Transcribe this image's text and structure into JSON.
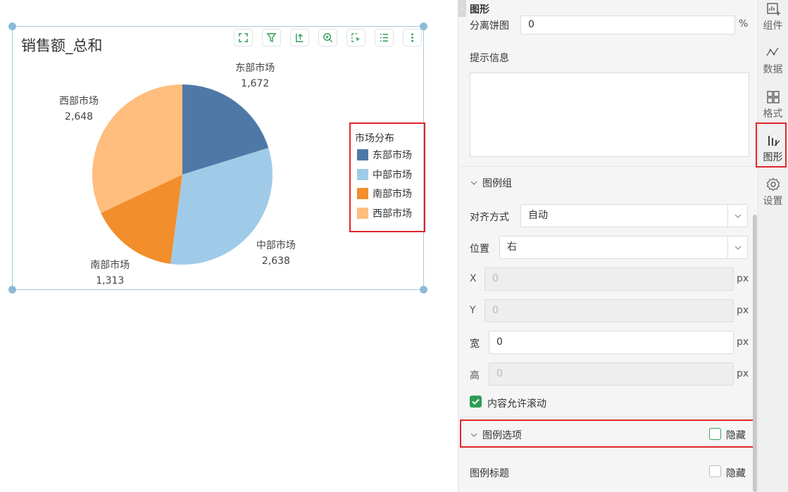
{
  "widget": {
    "title": "销售额_总和",
    "toolbar": [
      "expand-icon",
      "filter-icon",
      "drill-icon",
      "zoom-in-icon",
      "select-icon",
      "list-icon",
      "more-icon"
    ]
  },
  "chart_data": {
    "type": "pie",
    "title": "销售额_总和",
    "categories": [
      "东部市场",
      "中部市场",
      "南部市场",
      "西部市场"
    ],
    "values": [
      1672,
      2638,
      1313,
      2648
    ],
    "value_labels": [
      "1,672",
      "2,638",
      "1,313",
      "2,648"
    ],
    "colors": [
      "#4e79a7",
      "#a0cbe8",
      "#f28e2b",
      "#ffbe7d"
    ],
    "legend": {
      "title": "市场分布",
      "placement": "right",
      "items": [
        "东部市场",
        "中部市场",
        "南部市场",
        "西部市场"
      ]
    }
  },
  "panel": {
    "collapse_glyph": "›",
    "title": "图形",
    "separation_label": "分离饼图",
    "separation_value": "0",
    "separation_unit": "%",
    "tooltip_label": "提示信息",
    "legend_group": {
      "header": "图例组",
      "align_label": "对齐方式",
      "align_value": "自动",
      "position_label": "位置",
      "position_value": "右",
      "x_label": "X",
      "x_value": "0",
      "y_label": "Y",
      "y_value": "0",
      "width_label": "宽",
      "width_value": "0",
      "height_label": "高",
      "height_value": "0",
      "unit": "px",
      "scroll_label": "内容允许滚动",
      "scroll_checked": true
    },
    "legend_options": {
      "header": "图例选项",
      "hide_label": "隐藏",
      "hide_checked": false
    },
    "legend_title": {
      "label": "图例标题",
      "hide_label": "隐藏",
      "hide_checked": false
    }
  },
  "rail": {
    "items": [
      {
        "label": "组件",
        "icon": "component-add-icon"
      },
      {
        "label": "数据",
        "icon": "data-icon"
      },
      {
        "label": "格式",
        "icon": "format-grid-icon"
      },
      {
        "label": "图形",
        "icon": "chart-icon",
        "active": true
      },
      {
        "label": "设置",
        "icon": "settings-gear-icon"
      }
    ]
  }
}
